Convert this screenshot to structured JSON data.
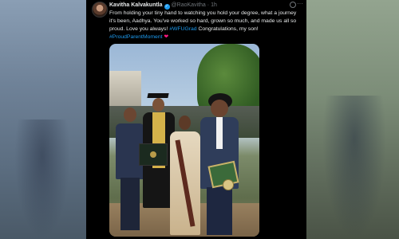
{
  "tweet": {
    "author_name": "Kavitha Kalvakuntla",
    "handle": "@RaoKavitha",
    "separator": "·",
    "time": "1h",
    "more_label": "···",
    "text_line1": "From holding your tiny hand to watching you hold your degree, what a journey it's been, Aadhya. You've worked so hard, grown so much, and made us all so proud. Love you always!",
    "hashtag1": "#WFUGrad",
    "text_line2": "Congratulations, my son!",
    "hashtag2": "#ProudParentMoment",
    "heart": "❤"
  },
  "icons": {
    "verified": "verified-badge-icon",
    "grok": "grok-icon",
    "more": "more-options-icon"
  },
  "colors": {
    "link": "#1d9bf0",
    "verified": "#1d9bf0",
    "heart": "#f91880",
    "background": "#000000"
  }
}
